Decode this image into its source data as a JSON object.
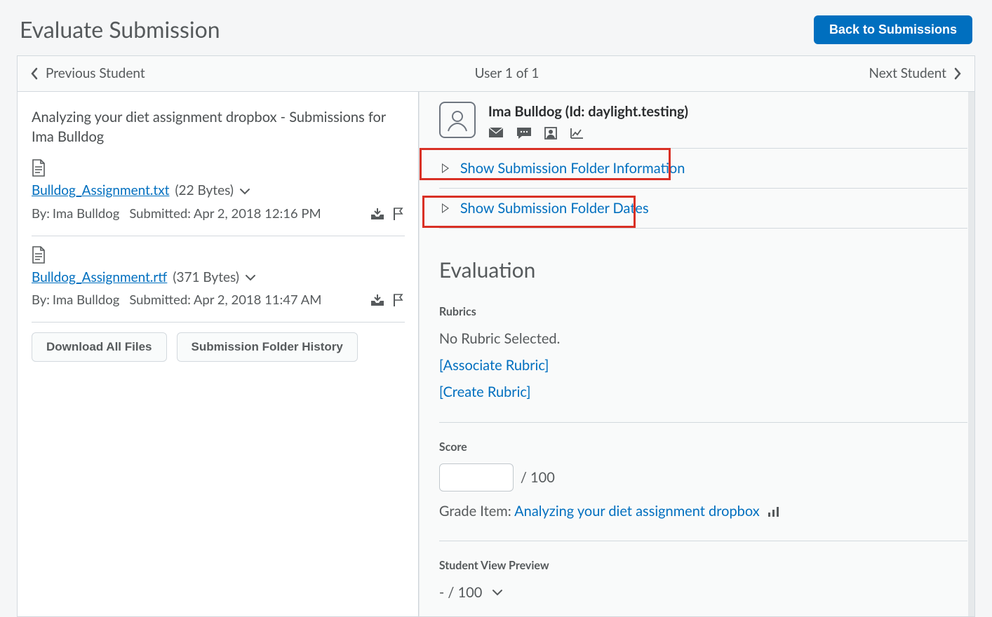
{
  "header": {
    "title": "Evaluate Submission",
    "back_button": "Back to Submissions"
  },
  "nav": {
    "prev": "Previous Student",
    "position": "User 1 of 1",
    "next": "Next Student"
  },
  "left": {
    "heading": "Analyzing your diet assignment dropbox - Submissions for Ima Bulldog",
    "files": [
      {
        "name": "Bulldog_Assignment.txt",
        "size": "(22 Bytes)",
        "by_label": "By:",
        "by": "Ima Bulldog",
        "submitted_label": "Submitted:",
        "submitted": "Apr 2, 2018 12:16 PM"
      },
      {
        "name": "Bulldog_Assignment.rtf",
        "size": "(371 Bytes)",
        "by_label": "By:",
        "by": "Ima Bulldog",
        "submitted_label": "Submitted:",
        "submitted": "Apr 2, 2018 11:47 AM"
      }
    ],
    "download_btn": "Download All Files",
    "history_btn": "Submission Folder History"
  },
  "right": {
    "user_name": "Ima Bulldog (Id: daylight.testing)",
    "expand_info": "Show Submission Folder Information",
    "expand_dates": "Show Submission Folder Dates",
    "eval_heading": "Evaluation",
    "rubrics_label": "Rubrics",
    "no_rubric": "No Rubric Selected.",
    "associate_rubric": "[Associate Rubric]",
    "create_rubric": "[Create Rubric]",
    "score_label": "Score",
    "score_denom": "/ 100",
    "grade_item_label": "Grade Item:",
    "grade_item_link": "Analyzing your diet assignment dropbox",
    "preview_label": "Student View Preview",
    "preview_value": "- / 100"
  }
}
